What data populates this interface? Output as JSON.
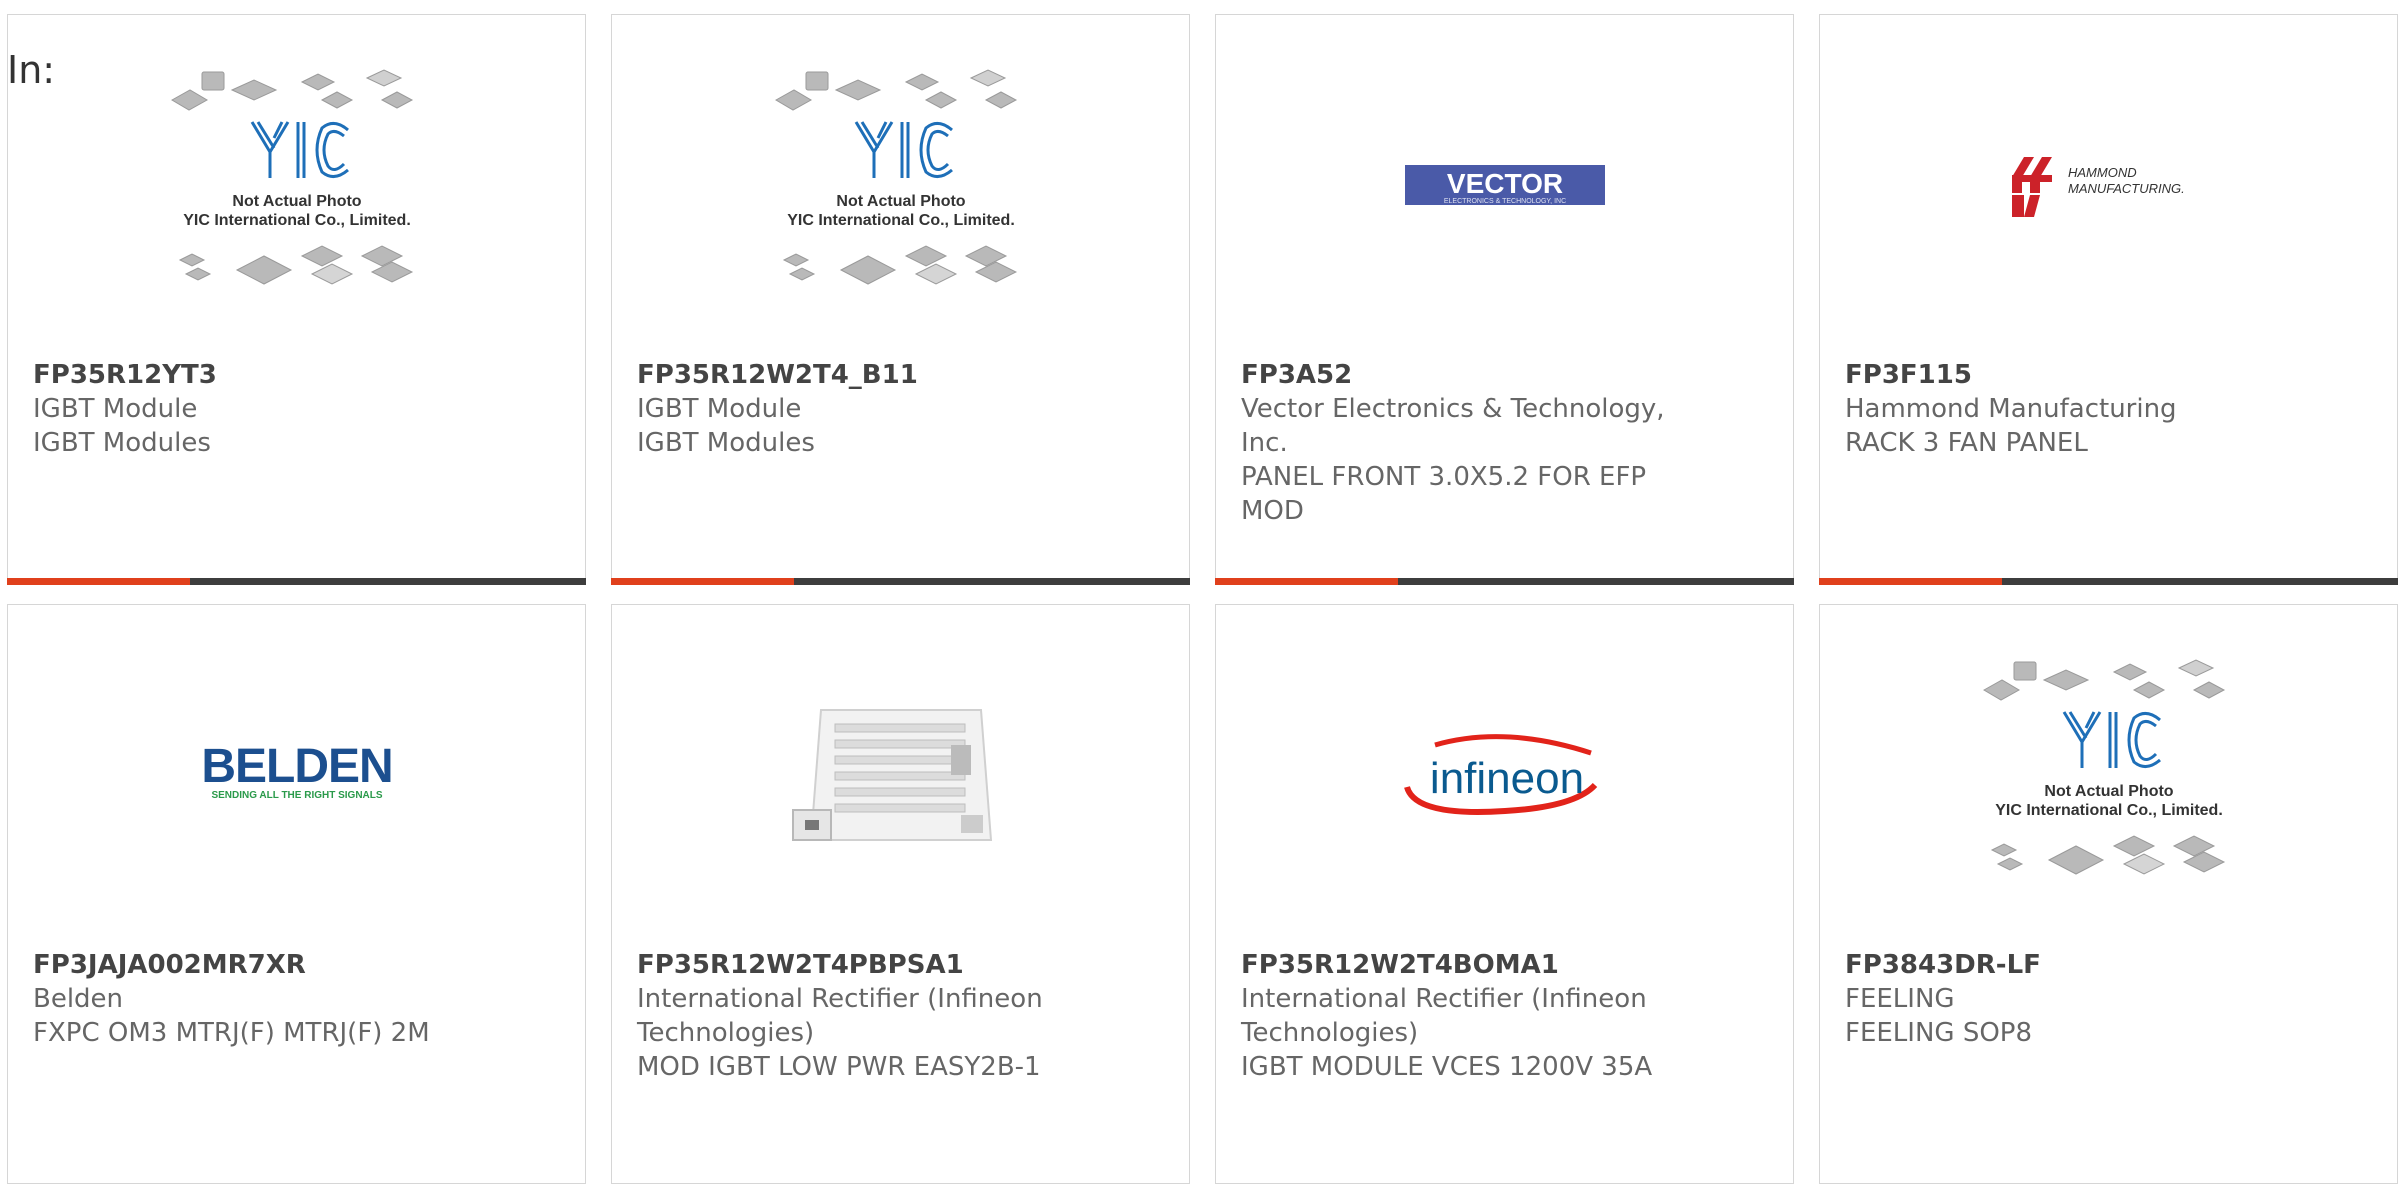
{
  "filter": {
    "label": "In:"
  },
  "colors": {
    "accent": "#e0401c",
    "bar": "#3d3d3d",
    "border": "#d6d6d6",
    "yic_blue": "#1e6fb8"
  },
  "placeholder_image": {
    "line1": "Not Actual Photo",
    "line2": "YIC International Co., Limited."
  },
  "products": [
    {
      "part": "FP35R12YT3",
      "manufacturer": "IGBT Module",
      "description": "IGBT Modules",
      "image": "yic-placeholder"
    },
    {
      "part": "FP35R12W2T4_B11",
      "manufacturer": "IGBT Module",
      "description": "IGBT Modules",
      "image": "yic-placeholder"
    },
    {
      "part": "FP3A52",
      "manufacturer": "Vector Electronics & Technology, Inc.",
      "description": "PANEL FRONT 3.0X5.2 FOR EFP MOD",
      "image": "vector-logo",
      "logo": {
        "name": "VECTOR",
        "tagline": "ELECTRONICS & TECHNOLOGY, INC"
      }
    },
    {
      "part": "FP3F115",
      "manufacturer": "Hammond Manufacturing",
      "description": "RACK 3 FAN PANEL",
      "image": "hammond-logo",
      "logo": {
        "name": "HAMMOND",
        "tagline": "MANUFACTURING."
      }
    },
    {
      "part": "FP3JAJA002MR7XR",
      "manufacturer": "Belden",
      "description": "FXPC OM3 MTRJ(F) MTRJ(F) 2M",
      "image": "belden-logo",
      "logo": {
        "name": "BELDEN",
        "tagline": "SENDING ALL THE RIGHT SIGNALS"
      }
    },
    {
      "part": "FP35R12W2T4PBPSA1",
      "manufacturer": "International Rectifier (Infineon Technologies)",
      "description": "MOD IGBT LOW PWR EASY2B-1",
      "image": "igbt-module-photo"
    },
    {
      "part": "FP35R12W2T4BOMA1",
      "manufacturer": "International Rectifier (Infineon Technologies)",
      "description": "IGBT MODULE VCES 1200V 35A",
      "image": "infineon-logo",
      "logo": {
        "name": "infineon"
      }
    },
    {
      "part": "FP3843DR-LF",
      "manufacturer": "FEELING",
      "description": "FEELING SOP8",
      "image": "yic-placeholder"
    }
  ]
}
